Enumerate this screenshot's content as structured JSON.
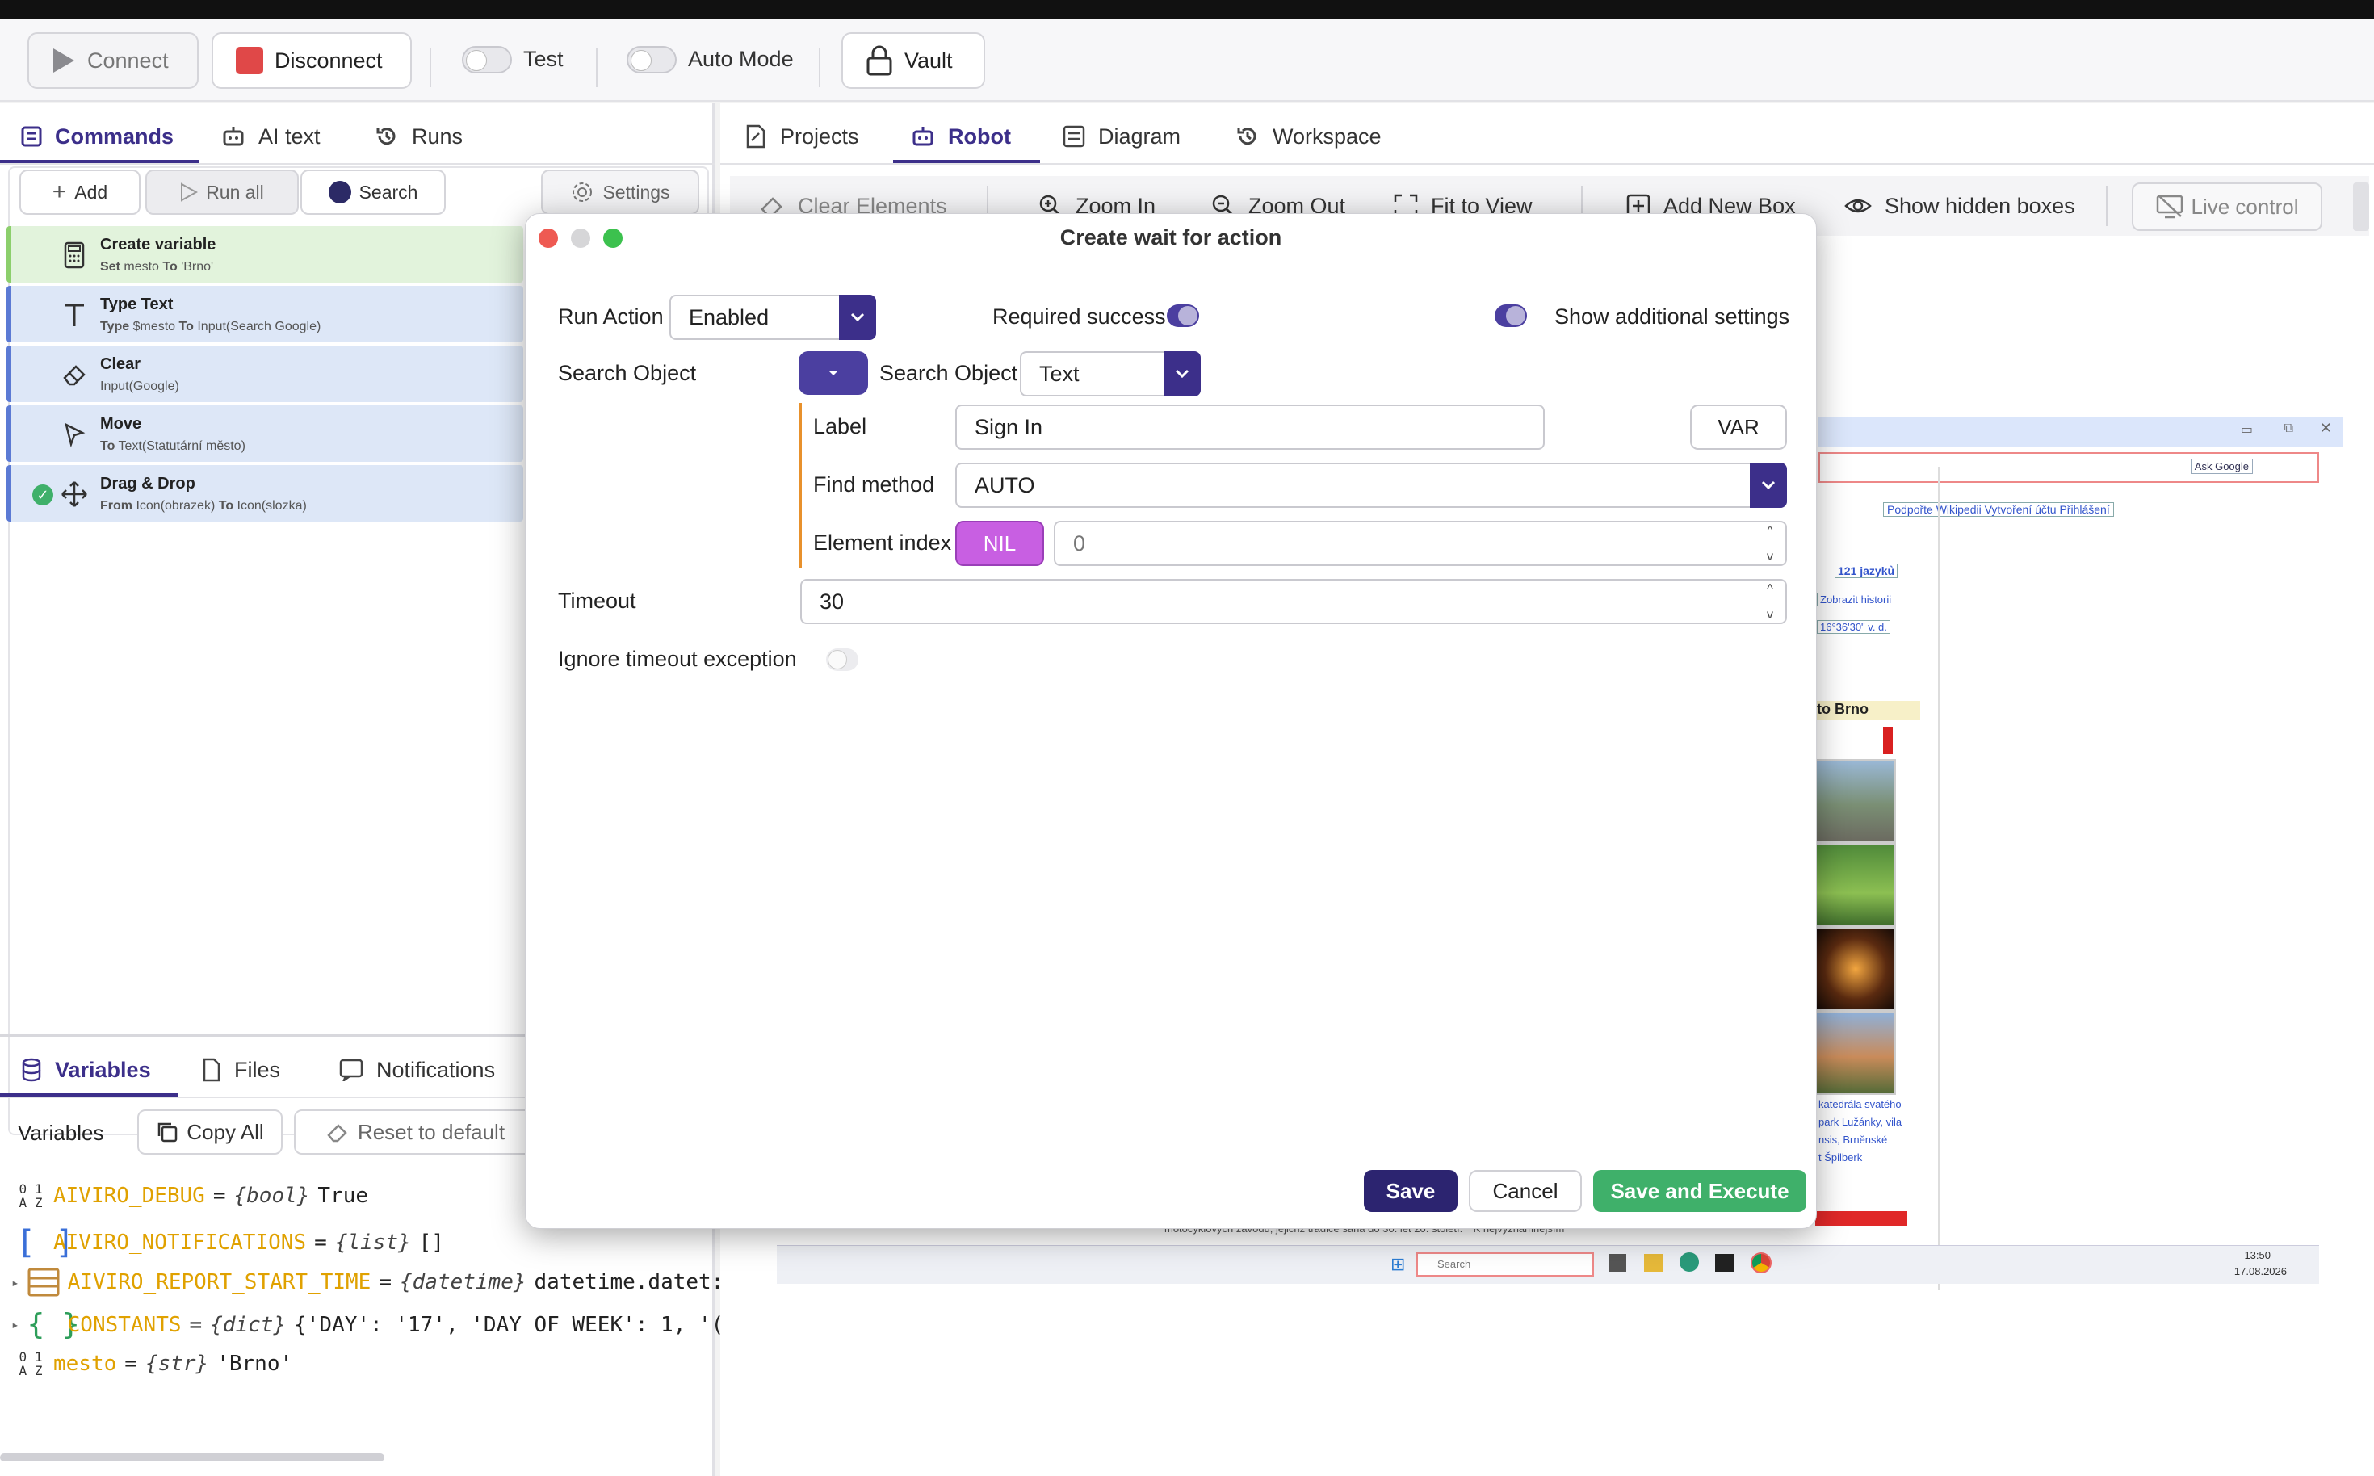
{
  "toolbar": {
    "connect": "Connect",
    "disconnect": "Disconnect",
    "test": "Test",
    "auto_mode": "Auto Mode",
    "vault": "Vault"
  },
  "left_tabs": {
    "commands": "Commands",
    "ai_text": "AI text",
    "runs": "Runs"
  },
  "command_bar": {
    "add": "Add",
    "run_all": "Run all",
    "search": "Search",
    "settings": "Settings"
  },
  "commands": [
    {
      "title": "Create variable",
      "parts": [
        "Set",
        "mesto",
        "To",
        "'Brno'"
      ]
    },
    {
      "title": "Type Text",
      "parts": [
        "Type",
        "$mesto",
        "To",
        "Input(Search Google)"
      ]
    },
    {
      "title": "Clear",
      "parts": [
        "",
        "Input(Google)",
        "",
        ""
      ]
    },
    {
      "title": "Move",
      "parts": [
        "To",
        "Text(Statutární město)",
        "",
        ""
      ]
    },
    {
      "title": "Drag & Drop",
      "parts": [
        "From",
        "Icon(obrazek)",
        "To",
        "Icon(slozka)"
      ]
    }
  ],
  "bottom_tabs": {
    "variables": "Variables",
    "files": "Files",
    "notifications": "Notifications"
  },
  "variables_bar": {
    "label": "Variables",
    "copy_all": "Copy All",
    "reset": "Reset to default"
  },
  "variables": [
    {
      "name": "AIVIRO_DEBUG",
      "eq": "=",
      "type": "{bool}",
      "value": "True"
    },
    {
      "name": "AIVIRO_NOTIFICATIONS",
      "eq": "=",
      "type": "{list}",
      "value": "[]"
    },
    {
      "name": "AIVIRO_REPORT_START_TIME",
      "eq": "=",
      "type": "{datetime}",
      "value": "datetime.datet:"
    },
    {
      "name": "CONSTANTS",
      "eq": "=",
      "type": "{dict}",
      "value": "{'DAY': '17', 'DAY_OF_WEEK': 1, '("
    },
    {
      "name": "mesto",
      "eq": "=",
      "type": "{str}",
      "value": "'Brno'"
    }
  ],
  "right_tabs": {
    "projects": "Projects",
    "robot": "Robot",
    "diagram": "Diagram",
    "workspace": "Workspace"
  },
  "robot_toolbar": {
    "clear": "Clear Elements",
    "zoom_in": "Zoom In",
    "zoom_out": "Zoom Out",
    "fit": "Fit to View",
    "add_box": "Add New Box",
    "hidden": "Show hidden boxes",
    "live": "Live control"
  },
  "preview_texts": {
    "ask_google": "Ask Google",
    "wiki_links": "Podpořte Wikipedii  Vytvoření účtu  Přihlášení",
    "languages": "121 jazyků",
    "history": "Zobrazit historii",
    "coords": "16°36'30\" v. d.",
    "city": "to Brno",
    "caption1": "katedrála svatého",
    "caption2": "park Lužánky, vila",
    "caption3": "nsis, Brněnské",
    "caption4": "t Špilberk",
    "article": "motocyklových závodů, jejichž tradice sahá do 30. let 20. století. ^ K nejvýznamnějším",
    "search": "Search",
    "time": "13:50",
    "date": "17.08.2026"
  },
  "modal": {
    "title": "Create wait for action",
    "run_action_label": "Run Action",
    "run_action_value": "Enabled",
    "required_success": "Required success",
    "show_additional": "Show additional settings",
    "search_object_label": "Search Object",
    "search_object_inner": "Search Object",
    "search_object_value": "Text",
    "label_label": "Label",
    "label_value": "Sign In",
    "var_button": "VAR",
    "find_method_label": "Find method",
    "find_method_value": "AUTO",
    "element_index_label": "Element index",
    "nil_button": "NIL",
    "element_index_value": "0",
    "timeout_label": "Timeout",
    "timeout_value": "30",
    "ignore_timeout": "Ignore timeout exception",
    "save": "Save",
    "cancel": "Cancel",
    "save_execute": "Save and Execute"
  }
}
